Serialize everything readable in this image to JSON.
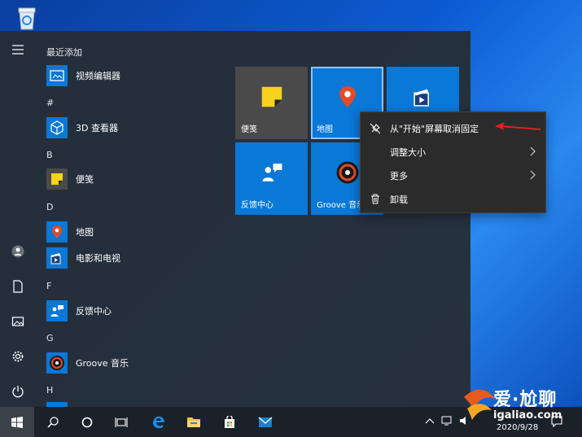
{
  "desktop": {
    "recycle_bin_icon": "recycle-bin-icon"
  },
  "rail": {
    "items": [
      "hamburger-icon",
      "user-icon",
      "document-icon",
      "pictures-icon",
      "settings-icon",
      "power-icon"
    ]
  },
  "applist": {
    "sections": [
      {
        "header": "最近添加",
        "apps": [
          {
            "label": "视频编辑器",
            "icon": "video-editor-icon"
          }
        ]
      },
      {
        "header": "#",
        "apps": [
          {
            "label": "3D 查看器",
            "icon": "3d-viewer-icon"
          }
        ]
      },
      {
        "header": "B",
        "apps": [
          {
            "label": "便笺",
            "icon": "sticky-notes-icon"
          }
        ]
      },
      {
        "header": "D",
        "apps": [
          {
            "label": "地图",
            "icon": "maps-icon"
          },
          {
            "label": "电影和电视",
            "icon": "movies-tv-icon"
          }
        ]
      },
      {
        "header": "F",
        "apps": [
          {
            "label": "反馈中心",
            "icon": "feedback-hub-icon"
          }
        ]
      },
      {
        "header": "G",
        "apps": [
          {
            "label": "Groove 音乐",
            "icon": "groove-music-icon"
          }
        ]
      },
      {
        "header": "H",
        "apps": []
      }
    ]
  },
  "tiles": [
    {
      "label": "便笺",
      "icon": "sticky-notes-icon",
      "color": "#4a4a4a"
    },
    {
      "label": "地图",
      "icon": "maps-icon",
      "color": "#0a78d7"
    },
    {
      "label": "",
      "icon": "movies-tv-icon",
      "color": "#0a78d7"
    },
    {
      "label": "反馈中心",
      "icon": "feedback-hub-icon",
      "color": "#0a78d7"
    },
    {
      "label": "Groove 音乐",
      "icon": "groove-music-icon",
      "color": "#0a78d7"
    }
  ],
  "context_menu": {
    "items": [
      {
        "label": "从\"开始\"屏幕取消固定",
        "icon": "unpin-icon"
      },
      {
        "label": "调整大小",
        "icon": "",
        "submenu": true
      },
      {
        "label": "更多",
        "icon": "",
        "submenu": true
      },
      {
        "label": "卸载",
        "icon": "trash-icon"
      }
    ]
  },
  "taskbar": {
    "items": [
      "start-icon",
      "search-icon",
      "cortana-icon",
      "task-view-icon",
      "edge-icon",
      "file-explorer-icon",
      "store-icon",
      "mail-icon"
    ],
    "date": "2020/9/28"
  },
  "watermark": {
    "text": "爱·尬聊",
    "url": "igaliao.com"
  },
  "colors": {
    "accent": "#0a78d7",
    "annotation_arrow": "#e02020"
  }
}
